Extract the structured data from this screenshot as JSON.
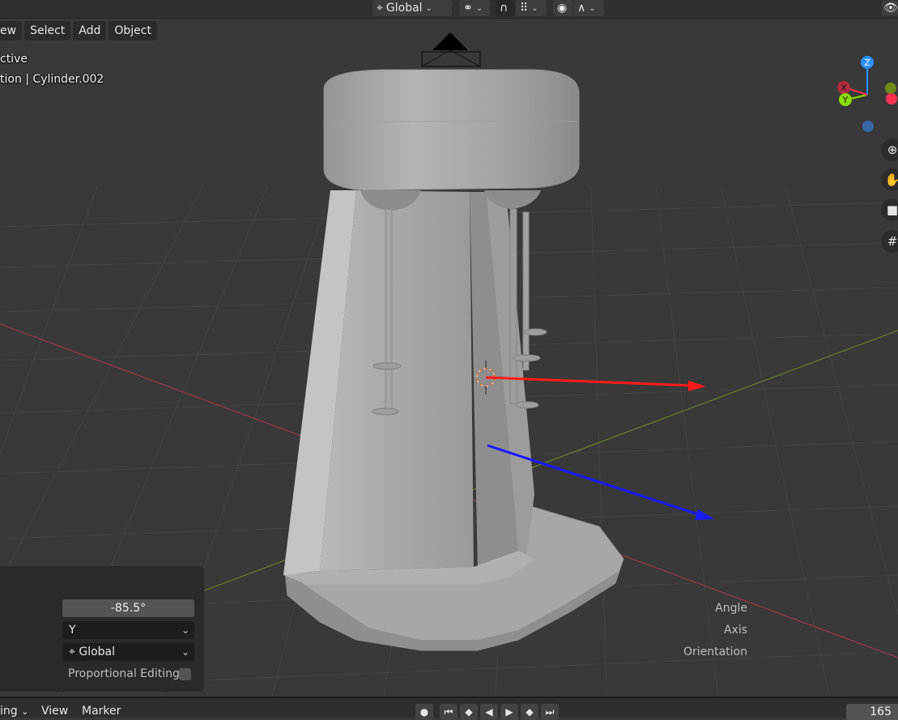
{
  "header": {
    "transform_orientation": "Global",
    "icons": [
      "transform-orientation-icon",
      "pivot-point-icon",
      "snap-icon",
      "snap-target-icon",
      "proportional-editing-icon",
      "falloff-icon"
    ]
  },
  "menu": {
    "view": "ew",
    "select": "Select",
    "add": "Add",
    "object": "Object"
  },
  "viewport_info": {
    "mode": "ctive",
    "object": "tion | Cylinder.002"
  },
  "gizmo": {
    "z": "Z",
    "y": "Y",
    "x": "X"
  },
  "axis_colors": {
    "x": "#ff3352",
    "y": "#8bdc00",
    "z": "#2890ff"
  },
  "operator": {
    "angle_label": "Angle",
    "angle_value": "-85.5°",
    "axis_label": "Axis",
    "axis_value": "Y",
    "orientation_label": "Orientation",
    "orientation_value": "Global",
    "proportional_label": "Proportional Editing"
  },
  "timeline": {
    "mode": "ing",
    "view": "View",
    "marker": "Marker",
    "current_frame": "165"
  }
}
